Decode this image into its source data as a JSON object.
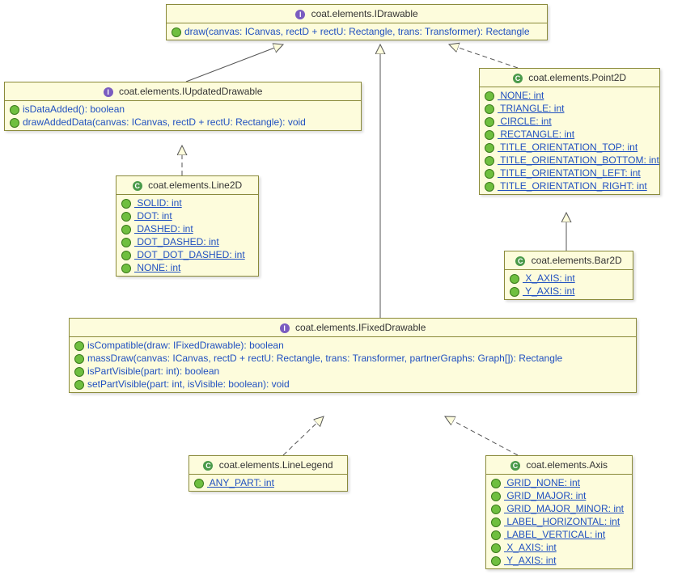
{
  "classes": {
    "IDrawable": {
      "kind": "interface",
      "title": "coat.elements.IDrawable",
      "members": [
        {
          "text": "draw(canvas: ICanvas, rectD + rectU: Rectangle, trans: Transformer): Rectangle",
          "static": false
        }
      ]
    },
    "IUpdatedDrawable": {
      "kind": "interface",
      "title": "coat.elements.IUpdatedDrawable",
      "members": [
        {
          "text": "isDataAdded(): boolean",
          "static": false
        },
        {
          "text": "drawAddedData(canvas: ICanvas, rectD + rectU: Rectangle): void",
          "static": false
        }
      ]
    },
    "Point2D": {
      "kind": "class",
      "title": "coat.elements.Point2D",
      "members": [
        {
          "text": " NONE: int",
          "static": true
        },
        {
          "text": " TRIANGLE: int",
          "static": true
        },
        {
          "text": " CIRCLE: int",
          "static": true
        },
        {
          "text": " RECTANGLE: int",
          "static": true
        },
        {
          "text": " TITLE_ORIENTATION_TOP: int",
          "static": true
        },
        {
          "text": " TITLE_ORIENTATION_BOTTOM: int",
          "static": true
        },
        {
          "text": " TITLE_ORIENTATION_LEFT: int",
          "static": true
        },
        {
          "text": " TITLE_ORIENTATION_RIGHT: int",
          "static": true
        }
      ]
    },
    "Line2D": {
      "kind": "class",
      "title": "coat.elements.Line2D",
      "members": [
        {
          "text": " SOLID: int",
          "static": true
        },
        {
          "text": " DOT: int",
          "static": true
        },
        {
          "text": " DASHED: int",
          "static": true
        },
        {
          "text": " DOT_DASHED: int",
          "static": true
        },
        {
          "text": " DOT_DOT_DASHED: int",
          "static": true
        },
        {
          "text": " NONE: int",
          "static": true
        }
      ]
    },
    "Bar2D": {
      "kind": "class",
      "title": "coat.elements.Bar2D",
      "members": [
        {
          "text": " X_AXIS: int",
          "static": true
        },
        {
          "text": " Y_AXIS: int",
          "static": true
        }
      ]
    },
    "IFixedDrawable": {
      "kind": "interface",
      "title": "coat.elements.IFixedDrawable",
      "members": [
        {
          "text": "isCompatible(draw: IFixedDrawable): boolean",
          "static": false
        },
        {
          "text": "massDraw(canvas: ICanvas, rectD + rectU: Rectangle, trans: Transformer, partnerGraphs: Graph[]): Rectangle",
          "static": false
        },
        {
          "text": "isPartVisible(part: int): boolean",
          "static": false
        },
        {
          "text": "setPartVisible(part: int, isVisible: boolean): void",
          "static": false
        }
      ]
    },
    "LineLegend": {
      "kind": "class",
      "title": "coat.elements.LineLegend",
      "members": [
        {
          "text": " ANY_PART: int",
          "static": true
        }
      ]
    },
    "Axis": {
      "kind": "class",
      "title": "coat.elements.Axis",
      "members": [
        {
          "text": " GRID_NONE: int",
          "static": true
        },
        {
          "text": " GRID_MAJOR: int",
          "static": true
        },
        {
          "text": " GRID_MAJOR_MINOR: int",
          "static": true
        },
        {
          "text": " LABEL_HORIZONTAL: int",
          "static": true
        },
        {
          "text": " LABEL_VERTICAL: int",
          "static": true
        },
        {
          "text": " X_AXIS: int",
          "static": true
        },
        {
          "text": " Y_AXIS: int",
          "static": true
        }
      ]
    }
  },
  "relations": [
    {
      "from": "IUpdatedDrawable",
      "to": "IDrawable",
      "type": "generalization"
    },
    {
      "from": "Point2D",
      "to": "IDrawable",
      "type": "realization"
    },
    {
      "from": "Line2D",
      "to": "IUpdatedDrawable",
      "type": "realization"
    },
    {
      "from": "Bar2D",
      "to": "Point2D",
      "type": "generalization"
    },
    {
      "from": "IFixedDrawable",
      "to": "IDrawable",
      "type": "generalization"
    },
    {
      "from": "LineLegend",
      "to": "IFixedDrawable",
      "type": "realization"
    },
    {
      "from": "Axis",
      "to": "IFixedDrawable",
      "type": "realization"
    }
  ]
}
